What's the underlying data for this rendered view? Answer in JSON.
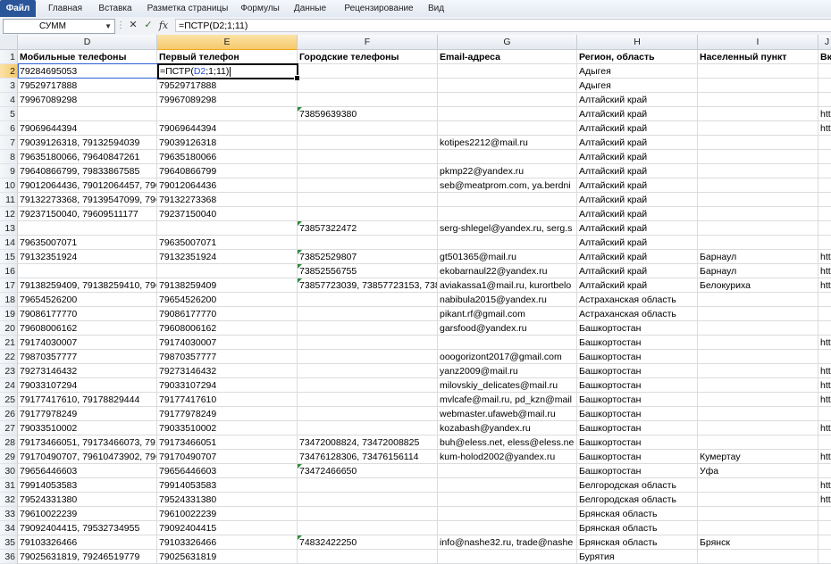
{
  "ribbon": {
    "tabs": [
      "Файл",
      "Главная",
      "Вставка",
      "Разметка страницы",
      "Формулы",
      "Данные",
      "Рецензирование",
      "Вид"
    ]
  },
  "formula_bar": {
    "name_box": "СУММ",
    "cancel_icon": "✕",
    "enter_icon": "✓",
    "fx_label": "fx",
    "formula": "=ПСТР(D2;1;11)"
  },
  "active_cell": {
    "prefix": "=ПСТР(",
    "ref": "D2",
    "suffix": ";1;11)"
  },
  "columns": [
    "D",
    "E",
    "F",
    "G",
    "H",
    "I",
    "J"
  ],
  "rows": [
    {
      "n": "1",
      "cells": [
        "Мобильные телефоны",
        "Первый телефон",
        "Городские телефоны",
        "Email-адреса",
        "Регион, область",
        "Населенный пункт",
        "Вк"
      ]
    },
    {
      "n": "2",
      "cells": [
        "79284695053",
        "",
        "",
        "",
        "Адыгея",
        "",
        ""
      ]
    },
    {
      "n": "3",
      "cells": [
        "79529717888",
        "79529717888",
        "",
        "",
        "Адыгея",
        "",
        ""
      ]
    },
    {
      "n": "4",
      "cells": [
        "79967089298",
        "79967089298",
        "",
        "",
        "Алтайский край",
        "",
        ""
      ]
    },
    {
      "n": "5",
      "cells": [
        "",
        "",
        "73859639380",
        "",
        "Алтайский край",
        "",
        "htt"
      ]
    },
    {
      "n": "6",
      "cells": [
        "79069644394",
        "79069644394",
        "",
        "",
        "Алтайский край",
        "",
        "htt"
      ]
    },
    {
      "n": "7",
      "cells": [
        "79039126318, 79132594039",
        "79039126318",
        "",
        "kotipes2212@mail.ru",
        "Алтайский край",
        "",
        ""
      ]
    },
    {
      "n": "8",
      "cells": [
        "79635180066, 79640847261",
        "79635180066",
        "",
        "",
        "Алтайский край",
        "",
        ""
      ]
    },
    {
      "n": "9",
      "cells": [
        "79640866799, 79833867585",
        "79640866799",
        "",
        "pkmp22@yandex.ru",
        "Алтайский край",
        "",
        ""
      ]
    },
    {
      "n": "10",
      "cells": [
        "79012064436, 79012064457, 7901",
        "79012064436",
        "",
        "seb@meatprom.com, ya.berdni",
        "Алтайский край",
        "",
        ""
      ]
    },
    {
      "n": "11",
      "cells": [
        "79132273368, 79139547099, 7963",
        "79132273368",
        "",
        "",
        "Алтайский край",
        "",
        ""
      ]
    },
    {
      "n": "12",
      "cells": [
        "79237150040, 79609511177",
        "79237150040",
        "",
        "",
        "Алтайский край",
        "",
        ""
      ]
    },
    {
      "n": "13",
      "cells": [
        "",
        "",
        "73857322472",
        "serg-shlegel@yandex.ru, serg.s",
        "Алтайский край",
        "",
        ""
      ]
    },
    {
      "n": "14",
      "cells": [
        "79635007071",
        "79635007071",
        "",
        "",
        "Алтайский край",
        "",
        ""
      ]
    },
    {
      "n": "15",
      "cells": [
        "79132351924",
        "79132351924",
        "73852529807",
        "gt501365@mail.ru",
        "Алтайский край",
        "Барнаул",
        "htt"
      ]
    },
    {
      "n": "16",
      "cells": [
        "",
        "",
        "73852556755",
        "ekobarnaul22@yandex.ru",
        "Алтайский край",
        "Барнаул",
        "htt"
      ]
    },
    {
      "n": "17",
      "cells": [
        "79138259409, 79138259410, 7961",
        "79138259409",
        "73857723039, 73857723153, 7385",
        "aviakassa1@mail.ru, kurortbelo",
        "Алтайский край",
        "Белокуриха",
        "htt"
      ]
    },
    {
      "n": "18",
      "cells": [
        "79654526200",
        "79654526200",
        "",
        "nabibula2015@yandex.ru",
        "Астраханская область",
        "",
        ""
      ]
    },
    {
      "n": "19",
      "cells": [
        "79086177770",
        "79086177770",
        "",
        "pikant.rf@gmail.com",
        "Астраханская область",
        "",
        ""
      ]
    },
    {
      "n": "20",
      "cells": [
        "79608006162",
        "79608006162",
        "",
        "garsfood@yandex.ru",
        "Башкортостан",
        "",
        ""
      ]
    },
    {
      "n": "21",
      "cells": [
        "79174030007",
        "79174030007",
        "",
        "",
        "Башкортостан",
        "",
        "htt"
      ]
    },
    {
      "n": "22",
      "cells": [
        "79870357777",
        "79870357777",
        "",
        "ooogorizont2017@gmail.com",
        "Башкортостан",
        "",
        ""
      ]
    },
    {
      "n": "23",
      "cells": [
        "79273146432",
        "79273146432",
        "",
        "yanz2009@mail.ru",
        "Башкортостан",
        "",
        "htt"
      ]
    },
    {
      "n": "24",
      "cells": [
        "79033107294",
        "79033107294",
        "",
        "milovskiy_delicates@mail.ru",
        "Башкортостан",
        "",
        "htt"
      ]
    },
    {
      "n": "25",
      "cells": [
        "79177417610, 79178829444",
        "79177417610",
        "",
        "mvlcafe@mail.ru, pd_kzn@mail",
        "Башкортостан",
        "",
        "htt"
      ]
    },
    {
      "n": "26",
      "cells": [
        "79177978249",
        "79177978249",
        "",
        "webmaster.ufaweb@mail.ru",
        "Башкортостан",
        "",
        ""
      ]
    },
    {
      "n": "27",
      "cells": [
        "79033510002",
        "79033510002",
        "",
        "kozabash@yandex.ru",
        "Башкортостан",
        "",
        "htt"
      ]
    },
    {
      "n": "28",
      "cells": [
        "79173466051, 79173466073, 7917",
        "79173466051",
        "73472008824, 73472008825",
        "buh@eless.net, eless@eless.ne",
        "Башкортостан",
        "",
        ""
      ]
    },
    {
      "n": "29",
      "cells": [
        "79170490707, 79610473902, 7961",
        "79170490707",
        "73476128306, 73476156114",
        "kum-holod2002@yandex.ru",
        "Башкортостан",
        "Кумертау",
        "htt"
      ]
    },
    {
      "n": "30",
      "cells": [
        "79656446603",
        "79656446603",
        "73472466650",
        "",
        "Башкортостан",
        "Уфа",
        ""
      ]
    },
    {
      "n": "31",
      "cells": [
        "79914053583",
        "79914053583",
        "",
        "",
        "Белгородская область",
        "",
        "htt"
      ]
    },
    {
      "n": "32",
      "cells": [
        "79524331380",
        "79524331380",
        "",
        "",
        "Белгородская область",
        "",
        "htt"
      ]
    },
    {
      "n": "33",
      "cells": [
        "79610022239",
        "79610022239",
        "",
        "",
        "Брянская область",
        "",
        ""
      ]
    },
    {
      "n": "34",
      "cells": [
        "79092404415, 79532734955",
        "79092404415",
        "",
        "",
        "Брянская область",
        "",
        ""
      ]
    },
    {
      "n": "35",
      "cells": [
        "79103326466",
        "79103326466",
        "74832422250",
        "info@nashe32.ru, trade@nashe",
        "Брянская область",
        "Брянск",
        ""
      ]
    },
    {
      "n": "36",
      "cells": [
        "79025631819, 79246519779",
        "79025631819",
        "",
        "",
        "Бурятия",
        "",
        ""
      ]
    }
  ],
  "colors": {
    "file_tab": "#2a5699",
    "selected_header": "#f5c96b",
    "text_triangle": "#2e8b3a",
    "reference": "#1f4fd6"
  }
}
